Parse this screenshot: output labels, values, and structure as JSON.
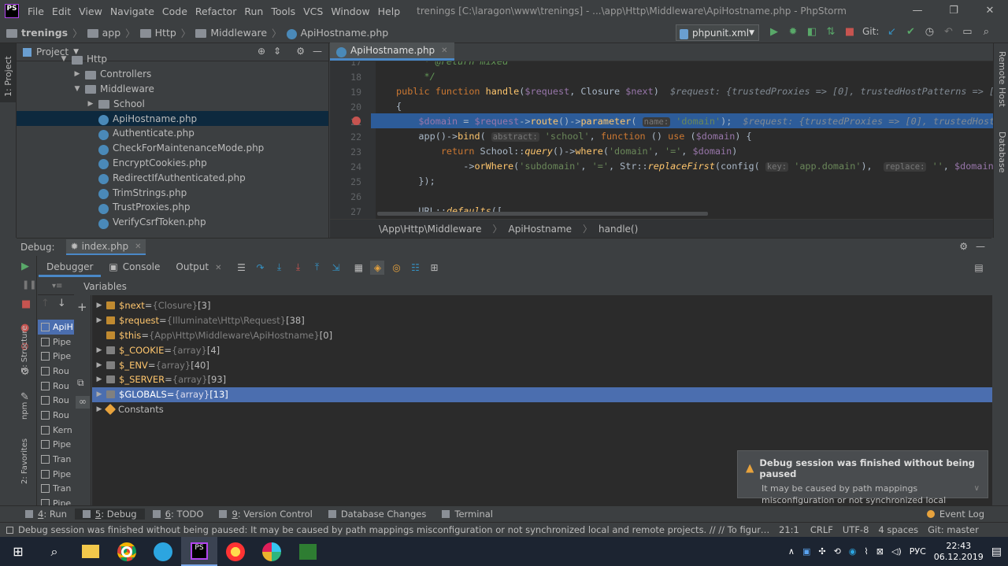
{
  "titlebar": {
    "menu": [
      "File",
      "Edit",
      "View",
      "Navigate",
      "Code",
      "Refactor",
      "Run",
      "Tools",
      "VCS",
      "Window",
      "Help"
    ],
    "title": "trenings [C:\\laragon\\www\\trenings] - ...\\app\\Http\\Middleware\\ApiHostname.php - PhpStorm",
    "logo": "PS"
  },
  "navbar": {
    "breadcrumbs": [
      "trenings",
      "app",
      "Http",
      "Middleware",
      "ApiHostname.php"
    ],
    "run_config": "phpunit.xml",
    "git_label": "Git:"
  },
  "project": {
    "header": "Project",
    "tree": [
      {
        "label": "Http",
        "depth": 0,
        "kind": "folder",
        "arrow": "▼"
      },
      {
        "label": "Controllers",
        "depth": 1,
        "kind": "folder",
        "arrow": "▶"
      },
      {
        "label": "Middleware",
        "depth": 1,
        "kind": "folder",
        "arrow": "▼"
      },
      {
        "label": "School",
        "depth": 2,
        "kind": "folder",
        "arrow": "▶"
      },
      {
        "label": "ApiHostname.php",
        "depth": 2,
        "kind": "php",
        "arrow": "",
        "selected": true
      },
      {
        "label": "Authenticate.php",
        "depth": 2,
        "kind": "php",
        "arrow": ""
      },
      {
        "label": "CheckForMaintenanceMode.php",
        "depth": 2,
        "kind": "php",
        "arrow": ""
      },
      {
        "label": "EncryptCookies.php",
        "depth": 2,
        "kind": "php",
        "arrow": ""
      },
      {
        "label": "RedirectIfAuthenticated.php",
        "depth": 2,
        "kind": "php",
        "arrow": ""
      },
      {
        "label": "TrimStrings.php",
        "depth": 2,
        "kind": "php",
        "arrow": ""
      },
      {
        "label": "TrustProxies.php",
        "depth": 2,
        "kind": "php",
        "arrow": ""
      },
      {
        "label": "VerifyCsrfToken.php",
        "depth": 2,
        "kind": "php",
        "arrow": ""
      }
    ]
  },
  "editor": {
    "tab": "ApiHostname.php",
    "line_numbers": [
      "17",
      "18",
      "19",
      "20",
      "21",
      "22",
      "23",
      "24",
      "25",
      "26",
      "27"
    ],
    "breadcrumb": [
      "\\App\\Http\\Middleware",
      "ApiHostname",
      "handle()"
    ]
  },
  "left_strip": {
    "tabs": [
      "1: Project",
      "7: Structure",
      "npm",
      "2: Favorites"
    ]
  },
  "right_strip": {
    "tabs": [
      "Remote Host",
      "Database"
    ]
  },
  "debug": {
    "label": "Debug:",
    "session": "index.php",
    "tabs": [
      "Debugger",
      "Console",
      "Output"
    ],
    "variables_label": "Variables",
    "frames": [
      "ApiH",
      "Pipe",
      "Pipe",
      "Rou",
      "Rou",
      "Rou",
      "Rou",
      "Kern",
      "Pipe",
      "Tran",
      "Pipe",
      "Tran",
      "Pipe"
    ],
    "variables": [
      {
        "name": "$next",
        "eq": " = ",
        "type": "{Closure}",
        "count": " [3]",
        "icon": "obj",
        "arrow": "▶"
      },
      {
        "name": "$request",
        "eq": " = ",
        "type": "{Illuminate\\Http\\Request}",
        "count": " [38]",
        "icon": "obj",
        "arrow": "▶"
      },
      {
        "name": "$this",
        "eq": " = ",
        "type": "{App\\Http\\Middleware\\ApiHostname}",
        "count": " [0]",
        "icon": "obj",
        "arrow": ""
      },
      {
        "name": "$_COOKIE",
        "eq": " = ",
        "type": "{array}",
        "count": " [4]",
        "icon": "grid",
        "arrow": "▶"
      },
      {
        "name": "$_ENV",
        "eq": " = ",
        "type": "{array}",
        "count": " [40]",
        "icon": "grid",
        "arrow": "▶"
      },
      {
        "name": "$_SERVER",
        "eq": " = ",
        "type": "{array}",
        "count": " [93]",
        "icon": "grid",
        "arrow": "▶"
      },
      {
        "name": "$GLOBALS",
        "eq": " = ",
        "type": "{array}",
        "count": " [13]",
        "icon": "grid",
        "arrow": "▶",
        "selected": true
      },
      {
        "name": "Constants",
        "eq": "",
        "type": "",
        "count": "",
        "icon": "const",
        "arrow": "▶"
      }
    ]
  },
  "notification": {
    "title": "Debug session was finished without being paused",
    "body": "It may be caused by path mappings misconfiguration or not synchronized local and..."
  },
  "bottom_tabs": [
    {
      "key": "4",
      "label": ": Run"
    },
    {
      "key": "5",
      "label": ": Debug",
      "active": true
    },
    {
      "key": "6",
      "label": ": TODO"
    },
    {
      "key": "9",
      "label": ": Version Control"
    },
    {
      "key": "",
      "label": "Database Changes"
    },
    {
      "key": "",
      "label": "Terminal"
    }
  ],
  "event_log": "Event Log",
  "status": {
    "message": "Debug session was finished without being paused: It may be caused by path mappings misconfiguration or not synchronized local and remote projects. // // To figure out the p... (moments ago)",
    "position": "21:1",
    "line_sep": "CRLF",
    "encoding": "UTF-8",
    "indent": "4 spaces",
    "vcs": "Git: master"
  },
  "taskbar": {
    "lang": "РУС",
    "time": "22:43",
    "date": "06.12.2019"
  }
}
